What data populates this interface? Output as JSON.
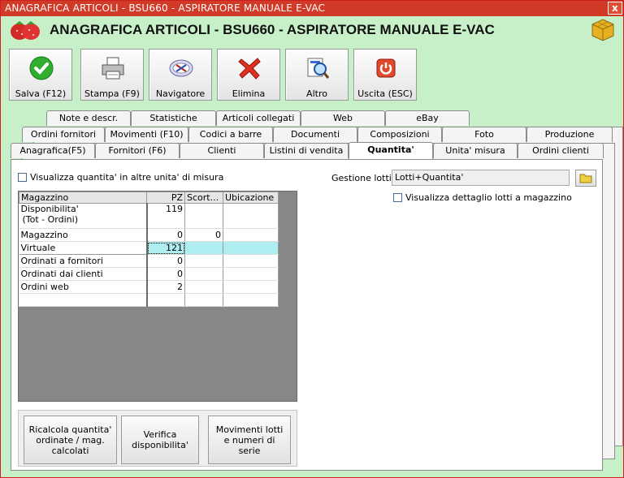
{
  "window": {
    "title": "ANAGRAFICA ARTICOLI - BSU660 - ASPIRATORE MANUALE E-VAC",
    "close_glyph": "x"
  },
  "header": {
    "title": "ANAGRAFICA ARTICOLI - BSU660 - ASPIRATORE MANUALE E-VAC"
  },
  "icons": {
    "logo": "strawberries-icon",
    "cube": "cube-icon",
    "salva": "checkmark-icon",
    "stampa": "printer-icon",
    "navigatore": "compass-icon",
    "elimina": "red-x-icon",
    "altro": "magnifier-icon",
    "uscita": "power-icon",
    "lotti": "folder-icon"
  },
  "toolbar": {
    "salva": "Salva (F12)",
    "stampa": "Stampa (F9)",
    "navigatore": "Navigatore",
    "elimina": "Elimina",
    "altro": "Altro",
    "uscita": "Uscita (ESC)"
  },
  "tabs": {
    "row1": [
      "Note e descr.",
      "Statistiche",
      "Articoli collegati",
      "Web",
      "eBay"
    ],
    "row2": [
      "Ordini fornitori",
      "Movimenti (F10)",
      "Codici a barre",
      "Documenti",
      "Composizioni",
      "Foto",
      "Produzione"
    ],
    "row3": [
      "Anagrafica(F5)",
      "Fornitori (F6)",
      "Clienti",
      "Listini di vendita",
      "Quantita'",
      "Unita' misura",
      "Ordini clienti"
    ],
    "active": "Quantita'"
  },
  "quantita": {
    "show_other_units_label": "Visualizza quantita' in altre unita' di misura",
    "show_other_units_checked": false,
    "grid": {
      "headers": [
        "Magazzino",
        "PZ",
        "Scort...",
        "Ubicazione"
      ],
      "rows": [
        {
          "name": "Disponibilita'",
          "name2": "(Tot - Ordini)",
          "pz": "119",
          "scorta": "",
          "ubicazione": ""
        },
        {
          "name": "Magazzino",
          "pz": "0",
          "scorta": "0",
          "ubicazione": ""
        },
        {
          "name": "Virtuale",
          "pz": "121",
          "scorta": "",
          "ubicazione": ""
        },
        {
          "name": "Ordinati a fornitori",
          "pz": "0",
          "scorta": "",
          "ubicazione": ""
        },
        {
          "name": "Ordinati dai clienti",
          "pz": "0",
          "scorta": "",
          "ubicazione": ""
        },
        {
          "name": "Ordini web",
          "pz": "2",
          "scorta": "",
          "ubicazione": ""
        }
      ]
    },
    "buttons": {
      "ricalcola": "Ricalcola quantita' ordinate / mag. calcolati",
      "verifica": "Verifica disponibilita'",
      "movimenti": "Movimenti lotti e numeri di serie"
    },
    "lotti": {
      "label": "Gestione lotti :",
      "value": "Lotti+Quantita'",
      "detail_label": "Visualizza dettaglio lotti a magazzino",
      "detail_checked": false
    }
  },
  "colors": {
    "titlebar": "#d23a28",
    "background": "#c8f0c8",
    "virtual_row": "#aeeef0",
    "grid_back": "#878787"
  }
}
